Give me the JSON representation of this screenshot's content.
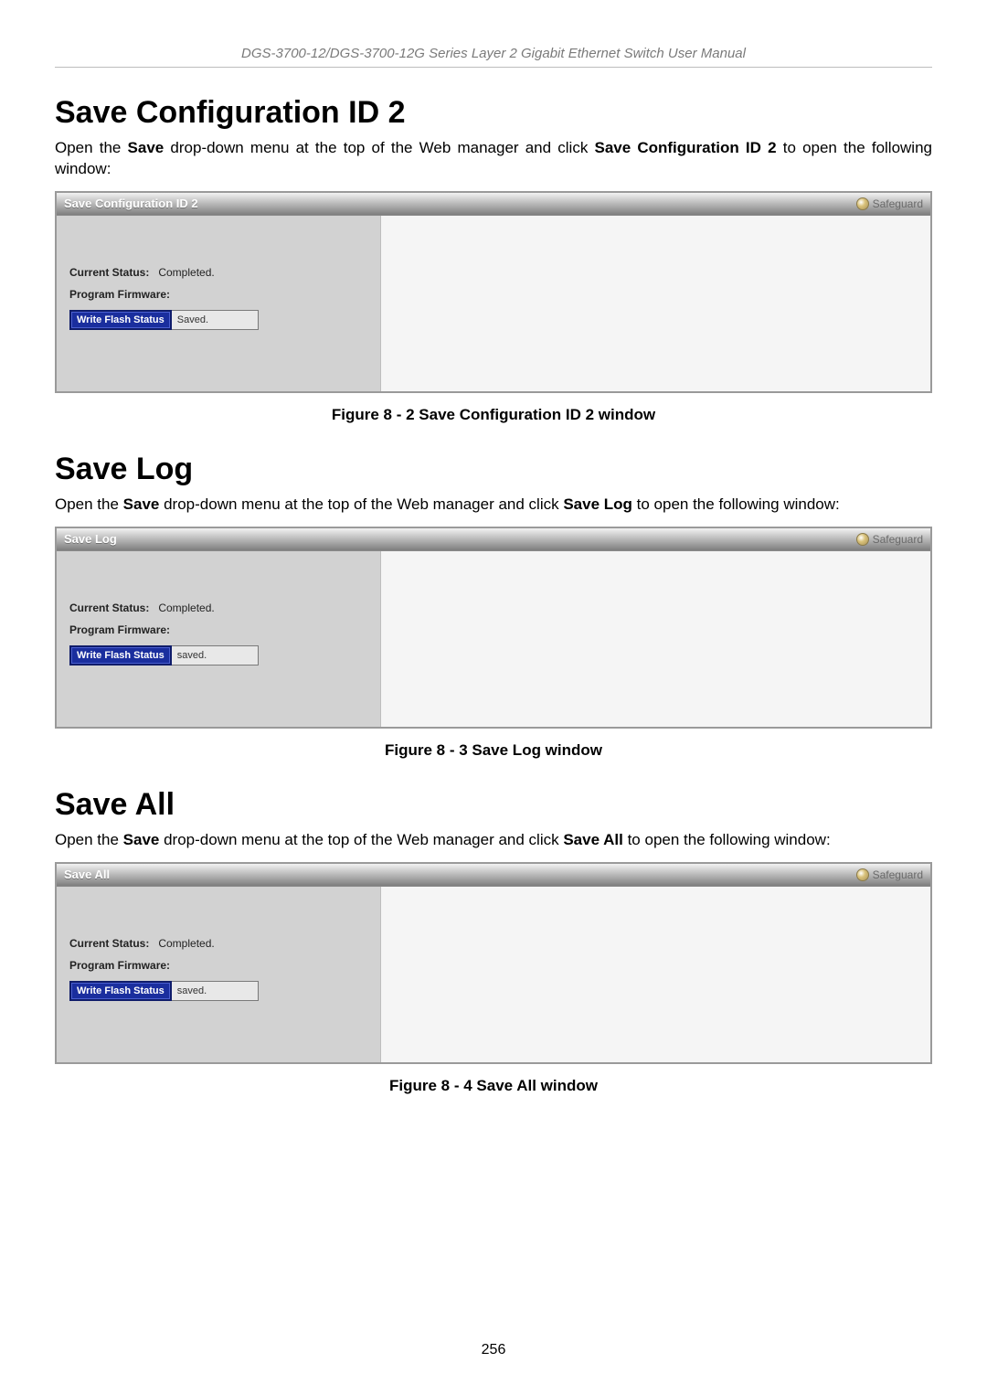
{
  "header": "DGS-3700-12/DGS-3700-12G Series Layer 2 Gigabit Ethernet Switch User Manual",
  "page_number": "256",
  "safeguard_label": "Safeguard",
  "sections": [
    {
      "title": "Save Configuration ID 2",
      "intro_pre": "Open the ",
      "intro_bold1": "Save",
      "intro_mid": " drop-down menu at the top of the Web manager and click ",
      "intro_bold2": "Save Configuration ID 2",
      "intro_post": " to open the following window:",
      "justify": true,
      "panel": {
        "title": "Save Configuration ID 2",
        "current_status_label": "Current Status:",
        "current_status_value": "Completed.",
        "program_firmware_label": "Program Firmware:",
        "flash_label": "Write Flash Status",
        "flash_value": "Saved."
      },
      "caption": "Figure 8 - 2 Save Configuration ID 2 window"
    },
    {
      "title": "Save Log",
      "intro_pre": "Open the ",
      "intro_bold1": "Save",
      "intro_mid": " drop-down menu at the top of the Web manager and click ",
      "intro_bold2": "Save Log",
      "intro_post": " to open the following window:",
      "justify": false,
      "panel": {
        "title": "Save Log",
        "current_status_label": "Current Status:",
        "current_status_value": "Completed.",
        "program_firmware_label": "Program Firmware:",
        "flash_label": "Write Flash Status",
        "flash_value": "saved."
      },
      "caption": "Figure 8 - 3 Save Log window"
    },
    {
      "title": "Save All",
      "intro_pre": "Open the ",
      "intro_bold1": "Save",
      "intro_mid": " drop-down menu at the top of the Web manager and click ",
      "intro_bold2": "Save All",
      "intro_post": " to open the following window:",
      "justify": false,
      "panel": {
        "title": "Save All",
        "current_status_label": "Current Status:",
        "current_status_value": "Completed.",
        "program_firmware_label": "Program Firmware:",
        "flash_label": "Write Flash Status",
        "flash_value": "saved."
      },
      "caption": "Figure 8 - 4 Save All window"
    }
  ]
}
